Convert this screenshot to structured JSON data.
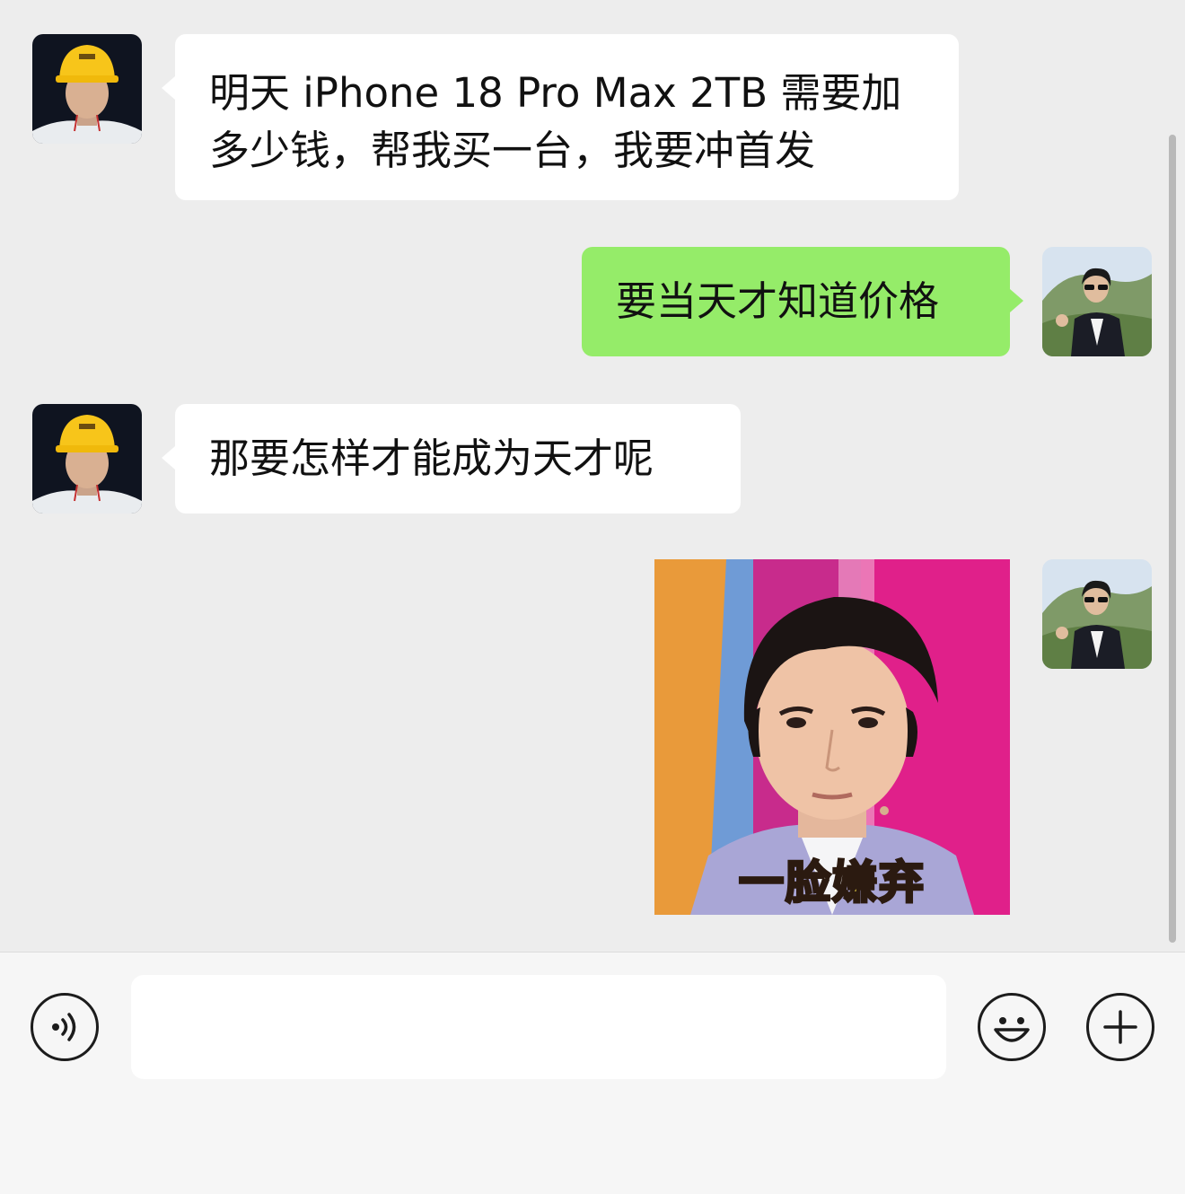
{
  "messages": [
    {
      "side": "left",
      "type": "text",
      "sender_avatar": "hardhat-man-avatar",
      "text": "明天 iPhone 18 Pro Max 2TB 需要加\n多少钱，帮我买一台，我要冲首发"
    },
    {
      "side": "right",
      "type": "text",
      "sender_avatar": "sunglasses-man-avatar",
      "text": "要当天才知道价格"
    },
    {
      "side": "left",
      "type": "text",
      "sender_avatar": "hardhat-man-avatar",
      "text": "那要怎样才能成为天才呢"
    },
    {
      "side": "right",
      "type": "sticker",
      "sender_avatar": "sunglasses-man-avatar",
      "caption": "一脸嫌弃"
    }
  ],
  "input_bar": {
    "voice_icon": "voice-icon",
    "input_value": "",
    "emoji_icon": "emoji-icon",
    "plus_icon": "plus-icon"
  },
  "colors": {
    "background": "#ededed",
    "outgoing_bubble": "#95ec69",
    "incoming_bubble": "#ffffff",
    "input_bar": "#f6f6f6"
  }
}
